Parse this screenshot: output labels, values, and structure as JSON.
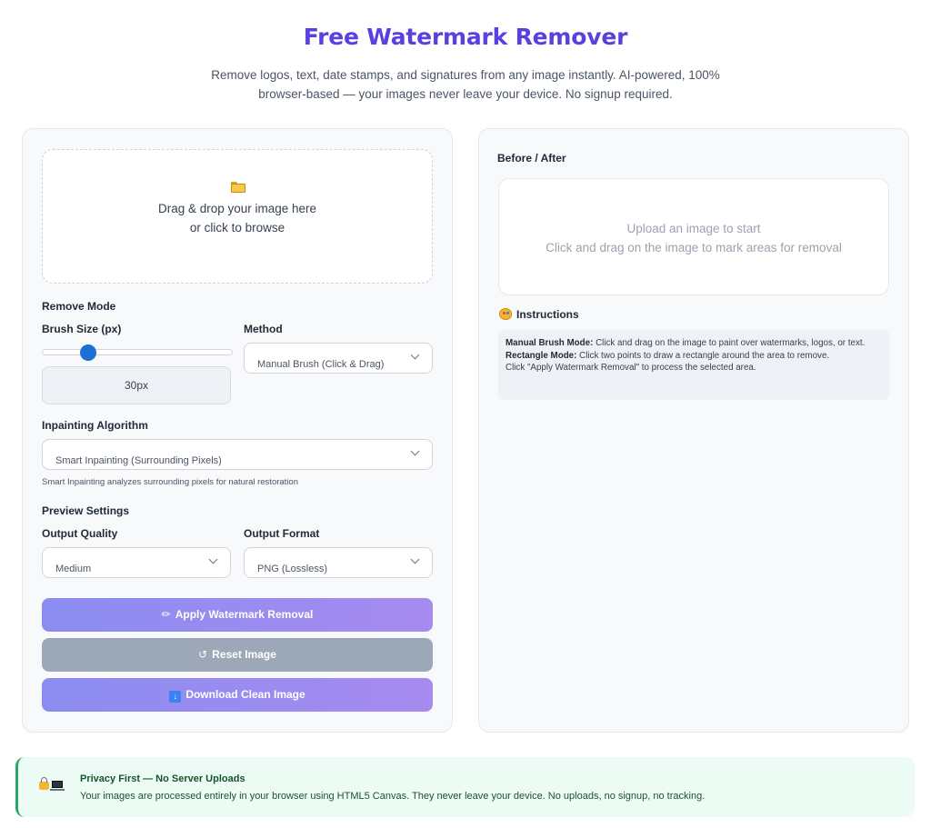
{
  "header": {
    "title": "Free Watermark Remover",
    "subtitle": "Remove logos, text, date stamps, and signatures from any image instantly. AI-powered, 100% browser-based — your images never leave your device. No signup required."
  },
  "upload": {
    "icon": "folder-icon",
    "line1": "Drag & drop your image here",
    "line2": "or click to browse"
  },
  "settings": {
    "remove_mode_label": "Remove Mode",
    "brush_size_label": "Brush Size (px)",
    "brush_size_value": 30,
    "brush_size_display": "30px",
    "method_label": "Method",
    "method_value": "Manual Brush (Click & Drag)",
    "algorithm_label": "Inpainting Algorithm",
    "algorithm_value": "Smart Inpainting (Surrounding Pixels)",
    "algorithm_hint": "Smart Inpainting analyzes surrounding pixels for natural restoration",
    "preview_settings_label": "Preview Settings",
    "quality_label": "Output Quality",
    "quality_value": "Medium",
    "format_label": "Output Format",
    "format_value": "PNG (Lossless)"
  },
  "buttons": {
    "apply_label": "Apply Watermark Removal",
    "reset_label": "Reset Image",
    "download_label": "Download Clean Image"
  },
  "preview": {
    "label": "Before / After",
    "line1": "Upload an image to start",
    "line2": "Click and drag on the image to mark areas for removal"
  },
  "instructions": {
    "heading": "Instructions",
    "manual_title": "Manual Brush Mode:",
    "manual_text": " Click and drag on the image to paint over watermarks, logos, or text.",
    "rect_title": "Rectangle Mode:",
    "rect_text": " Click two points to draw a rectangle around the area to remove.",
    "apply_text": "Click \"Apply Watermark Removal\" to process the selected area."
  },
  "privacy": {
    "title": "Privacy First — No Server Uploads",
    "text": "Your images are processed entirely in your browser using HTML5 Canvas. They never leave your device. No uploads, no signup, no tracking."
  },
  "colors": {
    "brand": "#5b3fe0",
    "button_gradient_start": "#8b8cf1",
    "button_gradient_end": "#a78bef",
    "reset_button": "#9ca8b7",
    "slider_thumb": "#1d6fd6",
    "privacy_accent": "#2aa56a"
  }
}
